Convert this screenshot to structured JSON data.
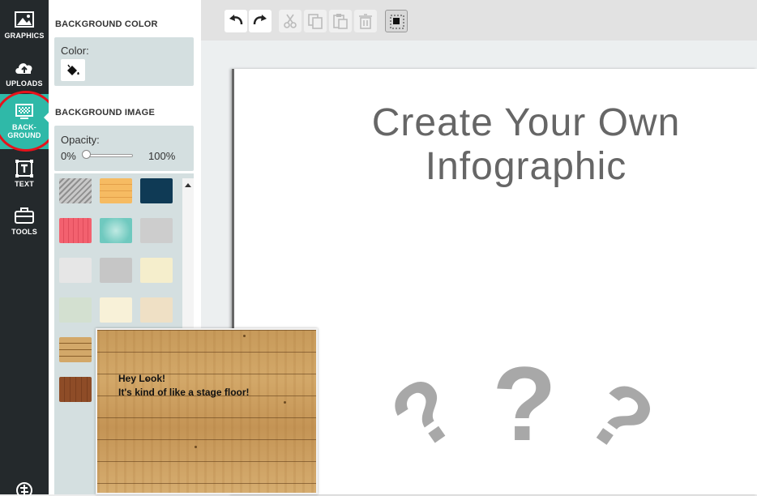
{
  "nav": {
    "items": [
      {
        "label": "GRAPHICS",
        "icon": "image-icon"
      },
      {
        "label": "UPLOADS",
        "icon": "cloud-upload-icon"
      },
      {
        "label": "BACK-",
        "label2": "GROUND",
        "icon": "monitor-pattern-icon"
      },
      {
        "label": "TEXT",
        "icon": "text-box-icon"
      },
      {
        "label": "TOOLS",
        "icon": "toolbox-icon"
      }
    ],
    "active": "BACKGROUND"
  },
  "panel": {
    "bg_color_title": "BACKGROUND COLOR",
    "color_label": "Color:",
    "bg_image_title": "BACKGROUND IMAGE",
    "opacity_label": "Opacity:",
    "opacity_min": "0%",
    "opacity_max": "100%",
    "opacity_value": 0
  },
  "swatches": [
    {
      "name": "gray-diagonal-stripes",
      "color": "#b0b0b0"
    },
    {
      "name": "orange-wood",
      "color": "#f2b15a"
    },
    {
      "name": "dark-navy",
      "color": "#0f3a55"
    },
    {
      "name": "red-wood",
      "color": "#f05a68"
    },
    {
      "name": "teal-bokeh",
      "color": "#6fc9bf"
    },
    {
      "name": "gray-clouds",
      "color": "#cdcdcd"
    },
    {
      "name": "light-gray",
      "color": "#e6e6e6"
    },
    {
      "name": "medium-gray",
      "color": "#c6c6c6"
    },
    {
      "name": "cream",
      "color": "#f5eecc"
    },
    {
      "name": "sage",
      "color": "#d3e0d0"
    },
    {
      "name": "ivory",
      "color": "#f8f1d8"
    },
    {
      "name": "beige",
      "color": "#efe0c5"
    },
    {
      "name": "wood-planks",
      "color": "#c99a55"
    },
    {
      "name": "white-grid",
      "color": "#f4f4f4"
    },
    {
      "name": "black-dots",
      "color": "#1a1a1a"
    },
    {
      "name": "dark-wood",
      "color": "#8a4a26"
    }
  ],
  "toolbar": {
    "undo": "undo-icon",
    "redo": "redo-icon",
    "cut": "scissors-icon",
    "copy": "copy-icon",
    "paste": "paste-icon",
    "delete": "trash-icon",
    "select": "select-box-icon"
  },
  "canvas": {
    "title_line1": "Create Your Own",
    "title_line2": "Infographic"
  },
  "tooltip": {
    "line1": "Hey Look!",
    "line2": "It's kind of like a stage floor!"
  },
  "colors": {
    "nav_bg": "#24292c",
    "accent": "#2fb9a8",
    "highlight": "#e8121b",
    "question_marks": "#a8a8a8"
  }
}
